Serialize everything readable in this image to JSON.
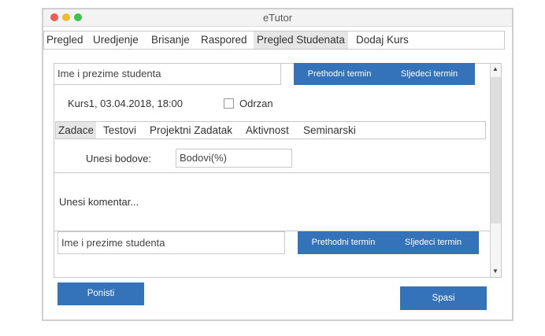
{
  "window": {
    "title": "eTutor",
    "traffic_lights": [
      {
        "name": "close",
        "color": "#ee5c56"
      },
      {
        "name": "minimize",
        "color": "#f2bb2c"
      },
      {
        "name": "maximize",
        "color": "#3fc34a"
      }
    ]
  },
  "menu": {
    "items": [
      "Pregled",
      "Uredjenje",
      "Brisanje",
      "Raspored",
      "Pregled Studenata",
      "Dodaj Kurs"
    ],
    "active": "Pregled Studenata"
  },
  "top": {
    "student_input": "Ime i prezime studenta",
    "prev_button": "Prethodni termin",
    "next_button": "Sljedeci termin"
  },
  "session": {
    "info": "Kurs1, 03.04.2018, 18:00",
    "held_label": "Odrzan",
    "held_checked": false
  },
  "tabs": {
    "items": [
      "Zadace",
      "Testovi",
      "Projektni Zadatak",
      "Aktivnost",
      "Seminarski"
    ],
    "active": "Zadace"
  },
  "points": {
    "label": "Unesi bodove:",
    "input_value": "Bodovi(%)"
  },
  "comment": {
    "placeholder": "Unesi komentar..."
  },
  "bottom": {
    "student_input": "Ime i prezime studenta",
    "prev_button": "Prethodni termin",
    "next_button": "Sljedeci termin"
  },
  "footer": {
    "cancel_button": "Ponisti",
    "save_button": "Spasi"
  },
  "colors": {
    "accent": "#3472b9",
    "active_tab_bg": "#e6e6e6",
    "border": "#c8c8c8"
  }
}
